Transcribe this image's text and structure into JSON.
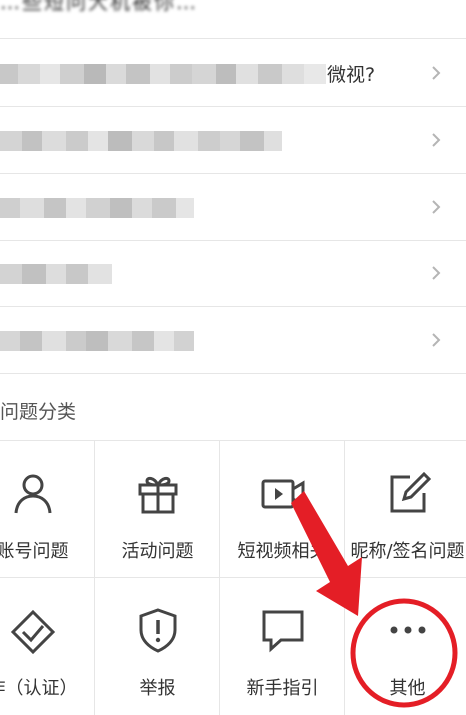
{
  "faq": {
    "top_partial": "…些短问大机被你…",
    "items": [
      {
        "visible_text": "微视?"
      },
      {
        "visible_text": ""
      },
      {
        "visible_text": ""
      },
      {
        "visible_text": ""
      },
      {
        "visible_text": ""
      }
    ]
  },
  "categories": {
    "section_label": "问题分类",
    "items": [
      {
        "label": "账号问题",
        "icon": "user-icon"
      },
      {
        "label": "活动问题",
        "icon": "gift-icon"
      },
      {
        "label": "短视频相关",
        "icon": "video-camera-icon"
      },
      {
        "label": "昵称/签名问题",
        "icon": "edit-icon"
      },
      {
        "label": "作（认证）",
        "icon": "verify-diamond-icon"
      },
      {
        "label": "举报",
        "icon": "shield-alert-icon"
      },
      {
        "label": "新手指引",
        "icon": "message-square-icon"
      },
      {
        "label": "其他",
        "icon": "more-dots-icon"
      }
    ]
  },
  "annotation": {
    "arrow_color": "#e41e26",
    "circle_color": "#e41e26"
  }
}
